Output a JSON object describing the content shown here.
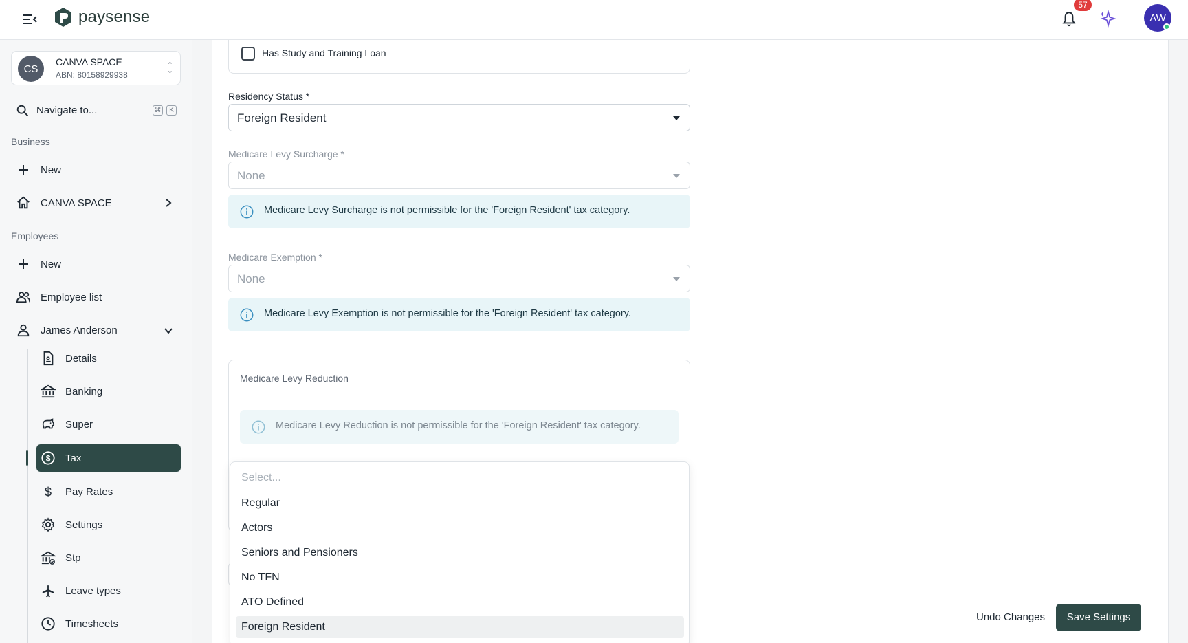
{
  "app": {
    "logo_text": "paysense",
    "notification_count": "57",
    "user_initials": "AW",
    "brand_color": "#2e4a47"
  },
  "sidebar": {
    "org": {
      "initials": "CS",
      "name": "CANVA SPACE",
      "abn": "ABN: 80158929938"
    },
    "search": {
      "label": "Navigate to...",
      "shortcut_mod": "⌘",
      "shortcut_key": "K"
    },
    "business_section": "Business",
    "business_new": "New",
    "business_org": "CANVA SPACE",
    "employees_section": "Employees",
    "employees_new": "New",
    "employee_list": "Employee list",
    "employee_name": "James Anderson",
    "employee_subitems": [
      {
        "label": "Details",
        "icon": "document-icon"
      },
      {
        "label": "Banking",
        "icon": "bank-icon"
      },
      {
        "label": "Super",
        "icon": "piggy-bank-icon"
      },
      {
        "label": "Tax",
        "icon": "dollar-circle-icon",
        "active": true
      },
      {
        "label": "Pay Rates",
        "icon": "dollar-icon"
      },
      {
        "label": "Settings",
        "icon": "gear-icon"
      },
      {
        "label": "Stp",
        "icon": "bank-check-icon"
      },
      {
        "label": "Leave types",
        "icon": "airplane-icon"
      },
      {
        "label": "Timesheets",
        "icon": "clock-icon"
      }
    ]
  },
  "form": {
    "study_loan_label": "Has Study and Training Loan",
    "study_loan_checked": false,
    "residency": {
      "label": "Residency Status",
      "required": "*",
      "value": "Foreign Resident"
    },
    "surcharge": {
      "label": "Medicare Levy Surcharge",
      "required": "*",
      "value": "None",
      "info": "Medicare Levy Surcharge is not permissible for the 'Foreign Resident' tax category."
    },
    "exemption": {
      "label": "Medicare Exemption",
      "required": "*",
      "value": "None",
      "info": "Medicare Levy Exemption is not permissible for the 'Foreign Resident' tax category."
    },
    "reduction": {
      "title": "Medicare Levy Reduction",
      "info": "Medicare Levy Reduction is not permissible for the 'Foreign Resident' tax category."
    }
  },
  "dropdown": {
    "placeholder": "Select...",
    "options": [
      "Regular",
      "Actors",
      "Seniors and Pensioners",
      "No TFN",
      "ATO Defined",
      "Foreign Resident"
    ],
    "selected": "Foreign Resident"
  },
  "actions": {
    "undo": "Undo Changes",
    "save": "Save Settings"
  }
}
